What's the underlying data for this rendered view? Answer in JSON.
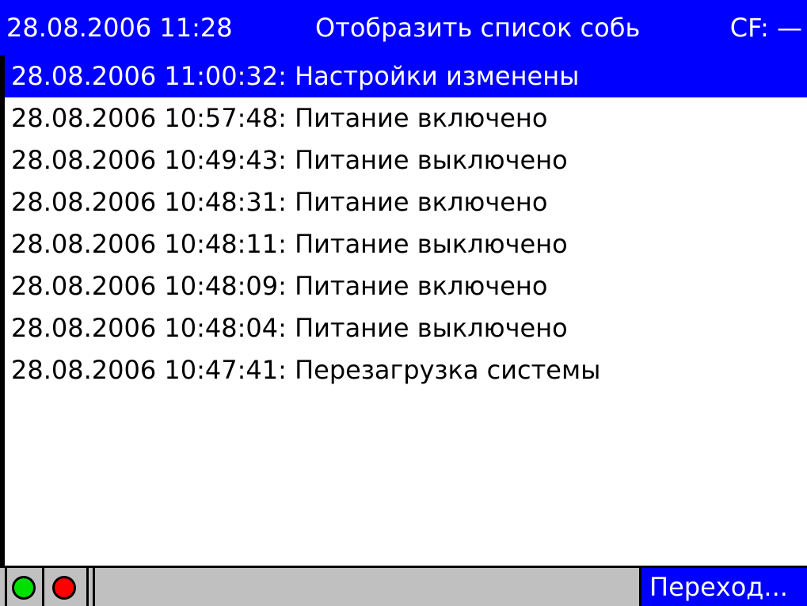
{
  "header": {
    "datetime": "28.08.2006 11:28",
    "title": "Отобразить список собь",
    "cf_status": "CF: —"
  },
  "events": [
    {
      "text": "28.08.2006 11:00:32: Настройки изменены",
      "selected": true
    },
    {
      "text": "28.08.2006 10:57:48: Питание включено",
      "selected": false
    },
    {
      "text": "28.08.2006 10:49:43: Питание выключено",
      "selected": false
    },
    {
      "text": "28.08.2006 10:48:31: Питание включено",
      "selected": false
    },
    {
      "text": "28.08.2006 10:48:11: Питание выключено",
      "selected": false
    },
    {
      "text": "28.08.2006 10:48:09: Питание включено",
      "selected": false
    },
    {
      "text": "28.08.2006 10:48:04: Питание выключено",
      "selected": false
    },
    {
      "text": "28.08.2006 10:47:41: Перезагрузка системы",
      "selected": false
    }
  ],
  "statusbar": {
    "indicators": [
      {
        "icon": "green-led-icon",
        "color": "#00e000"
      },
      {
        "icon": "red-led-icon",
        "color": "#ff0000"
      }
    ],
    "goto_label": "Переход..."
  },
  "colors": {
    "accent": "#0000ff",
    "background": "#ffffff",
    "statusbar": "#c0c0c0"
  }
}
